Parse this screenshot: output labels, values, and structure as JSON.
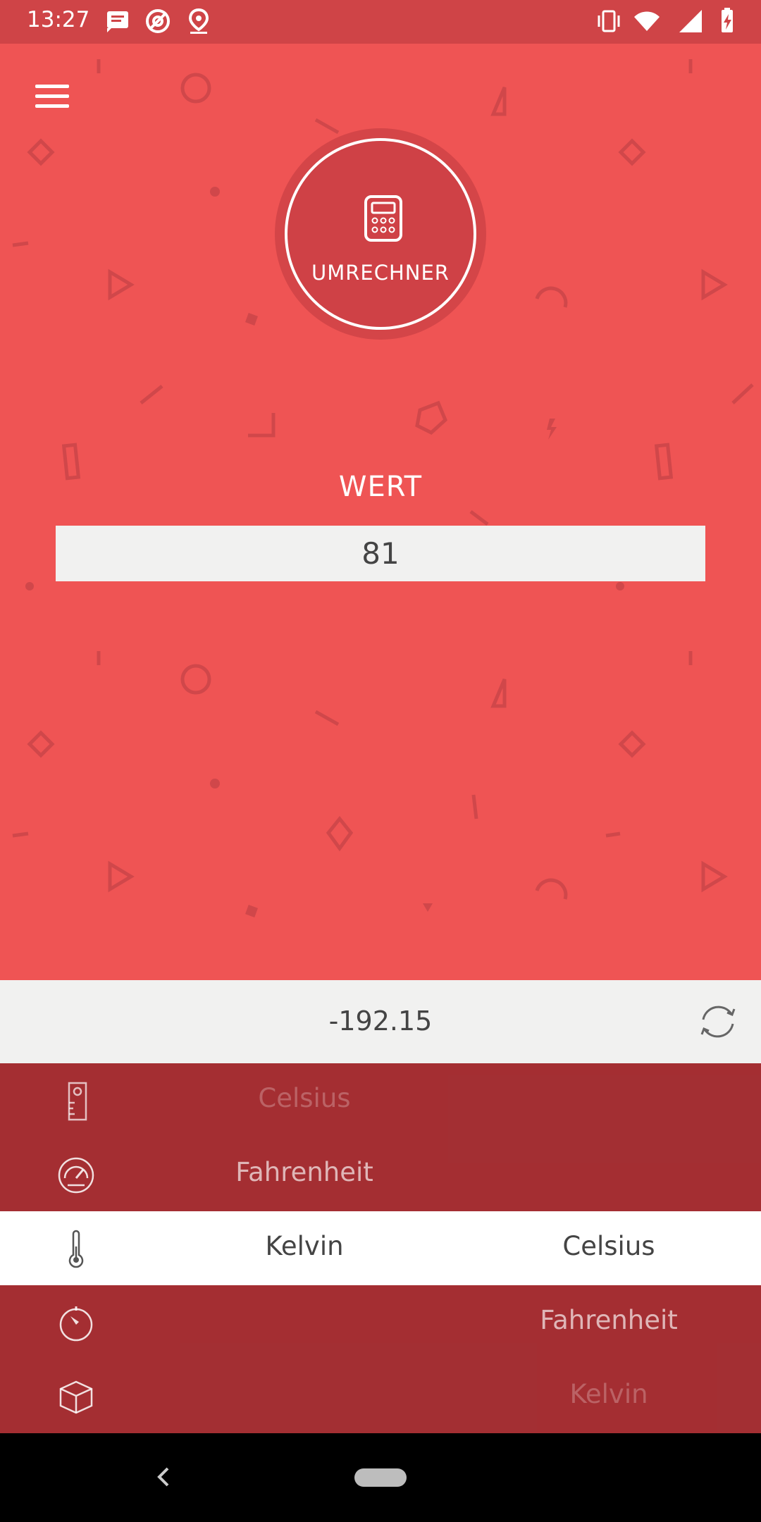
{
  "status_bar": {
    "time": "13:27",
    "icons_left": [
      "message-icon",
      "no-sync-icon",
      "location-icon"
    ],
    "icons_right": [
      "vibrate-icon",
      "wifi-icon",
      "signal-icon",
      "battery-charging-icon"
    ]
  },
  "header": {
    "menu_icon": "hamburger-menu-icon",
    "logo_icon": "calculator-icon",
    "logo_label": "UMRECHNER"
  },
  "input": {
    "label": "WERT",
    "value": "81"
  },
  "result": {
    "value": "-192.15",
    "swap_icon": "swap-refresh-icon"
  },
  "picker": {
    "rows": [
      {
        "icon": "ruler-icon",
        "from": "Celsius",
        "to": ""
      },
      {
        "icon": "speedometer-icon",
        "from": "Fahrenheit",
        "to": ""
      },
      {
        "icon": "thermometer-icon",
        "from": "Kelvin",
        "to": "Celsius"
      },
      {
        "icon": "timer-icon",
        "from": "",
        "to": "Fahrenheit"
      },
      {
        "icon": "cube-icon",
        "from": "",
        "to": "Kelvin"
      }
    ],
    "selected_index": 2
  },
  "colors": {
    "background": "#ef5454",
    "status_bar": "#cf4447",
    "picker": "#a3363b",
    "field": "#f1f1f0"
  },
  "nav_bar": {
    "back_icon": "back-chevron-icon",
    "home_icon": "home-pill-icon"
  }
}
